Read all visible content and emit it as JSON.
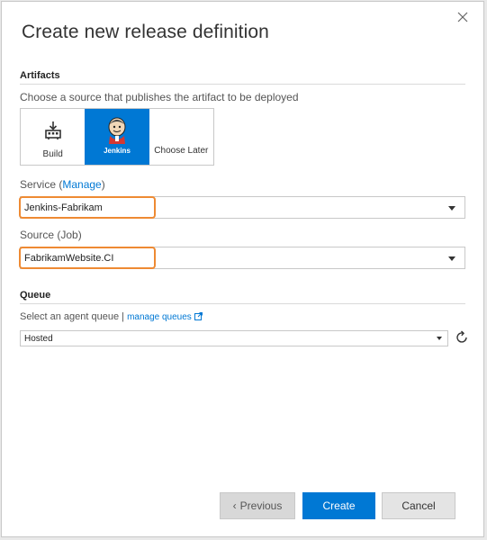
{
  "dialog": {
    "title": "Create new release definition"
  },
  "artifacts": {
    "heading": "Artifacts",
    "hint": "Choose a source that publishes the artifact to be deployed",
    "tiles": [
      {
        "label": "Build",
        "icon": "build-icon"
      },
      {
        "label": "Jenkins",
        "icon": "jenkins-icon",
        "selected": true
      },
      {
        "label": "Choose Later",
        "icon": ""
      }
    ],
    "service_label": "Service (",
    "service_link": "Manage",
    "service_label_close": ")",
    "service_value": "Jenkins-Fabrikam",
    "source_label": "Source (Job)",
    "source_value": "FabrikamWebsite.CI"
  },
  "queue": {
    "heading": "Queue",
    "hint": "Select an agent queue |",
    "manage_link": "manage queues",
    "value": "Hosted"
  },
  "buttons": {
    "previous": "Previous",
    "create": "Create",
    "cancel": "Cancel"
  },
  "colors": {
    "accent": "#0078d4",
    "highlight": "#ee8a33"
  }
}
